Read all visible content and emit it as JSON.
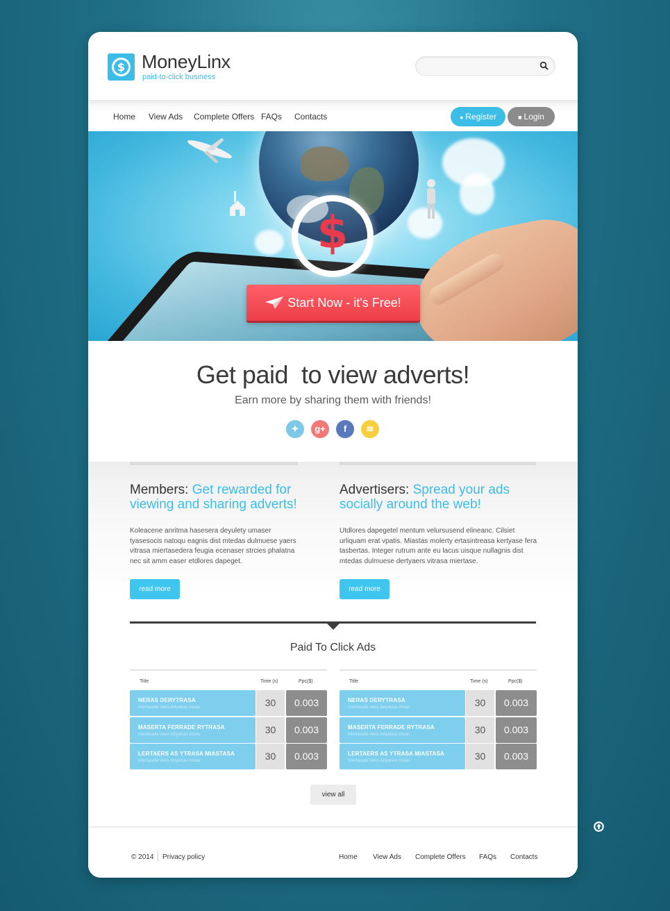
{
  "brand": {
    "name": "MoneyLinx",
    "tagline": "paid-to-click business",
    "logo_icon": "dollar-icon",
    "accent_color": "#3bbde8"
  },
  "search": {
    "placeholder": "",
    "icon": "search-icon"
  },
  "nav": {
    "items": [
      "Home",
      "View Ads",
      "Complete Offers",
      "FAQs",
      "Contacts"
    ],
    "register_label": "Register",
    "login_label": "Login"
  },
  "hero": {
    "cta_label": "Start Now - it's Free!",
    "cta_color": "#ec3e49",
    "symbol": "$"
  },
  "intro": {
    "heading": "Get paid  to view adverts!",
    "subheading": "Earn more by sharing them with friends!",
    "social": [
      "twitter-icon",
      "google-plus-icon",
      "facebook-icon",
      "rss-icon"
    ]
  },
  "members": {
    "lead": "Members:",
    "accent": "Get rewarded for viewing and sharing adverts!",
    "text": "Koleacene anritma hasesera deyulety umaser tyasesocis natoqu eagnis dist mtedas dulmuese yaers vitrasa miertasedera feugia ecenaser strcies phalatna nec sit amm easer etdlores dapeget.",
    "read_more": "read more"
  },
  "advertisers": {
    "lead": "Advertisers:",
    "accent": "Spread your ads socially around the web!",
    "text": "Utdlores dapegetel mentum velursusend elineanc. Cilsiet urliquam erat vpatis. Miastas molerty ertasintreasa kertyase fera tasbertas. Integer rutrum ante eu lacus uisque nullagnis dist mtedas dulmuese dertyaers vitrasa miertase.",
    "read_more": "read more"
  },
  "ads": {
    "title": "Paid To Click Ads",
    "columns": {
      "title": "Title",
      "time": "Time (s)",
      "ppc": "Ppc($)"
    },
    "left": [
      {
        "title": "NERAS DERYTRASA",
        "sub": "miertasade viera detyatsas miuas",
        "time": "30",
        "ppc": "0.003"
      },
      {
        "title": "MASERTA FERRADE RYTRASA",
        "sub": "miertasade viera detyatsas miuas",
        "time": "30",
        "ppc": "0.003"
      },
      {
        "title": "LERTAERS AS YTRASA MIASTASA",
        "sub": "miertasade viera detyatsas miuas",
        "time": "30",
        "ppc": "0.003"
      }
    ],
    "right": [
      {
        "title": "NERAS DERYTRASA",
        "sub": "miertasade viera detyatsas miuas",
        "time": "30",
        "ppc": "0.003"
      },
      {
        "title": "MASERTA FERRADE RYTRASA",
        "sub": "miertasade viera detyatsas miuas",
        "time": "30",
        "ppc": "0.003"
      },
      {
        "title": "LERTAERS AS YTRASA MIASTASA",
        "sub": "miertasade viera detyatsas miuas",
        "time": "30",
        "ppc": "0.003"
      }
    ],
    "view_all": "view all"
  },
  "footer": {
    "copyright": "© 2014",
    "privacy": "Privacy policy",
    "links": [
      "Home",
      "View Ads",
      "Complete Offers",
      "FAQs",
      "Contacts"
    ]
  },
  "back_to_top_icon": "arrow-up-circle-icon"
}
